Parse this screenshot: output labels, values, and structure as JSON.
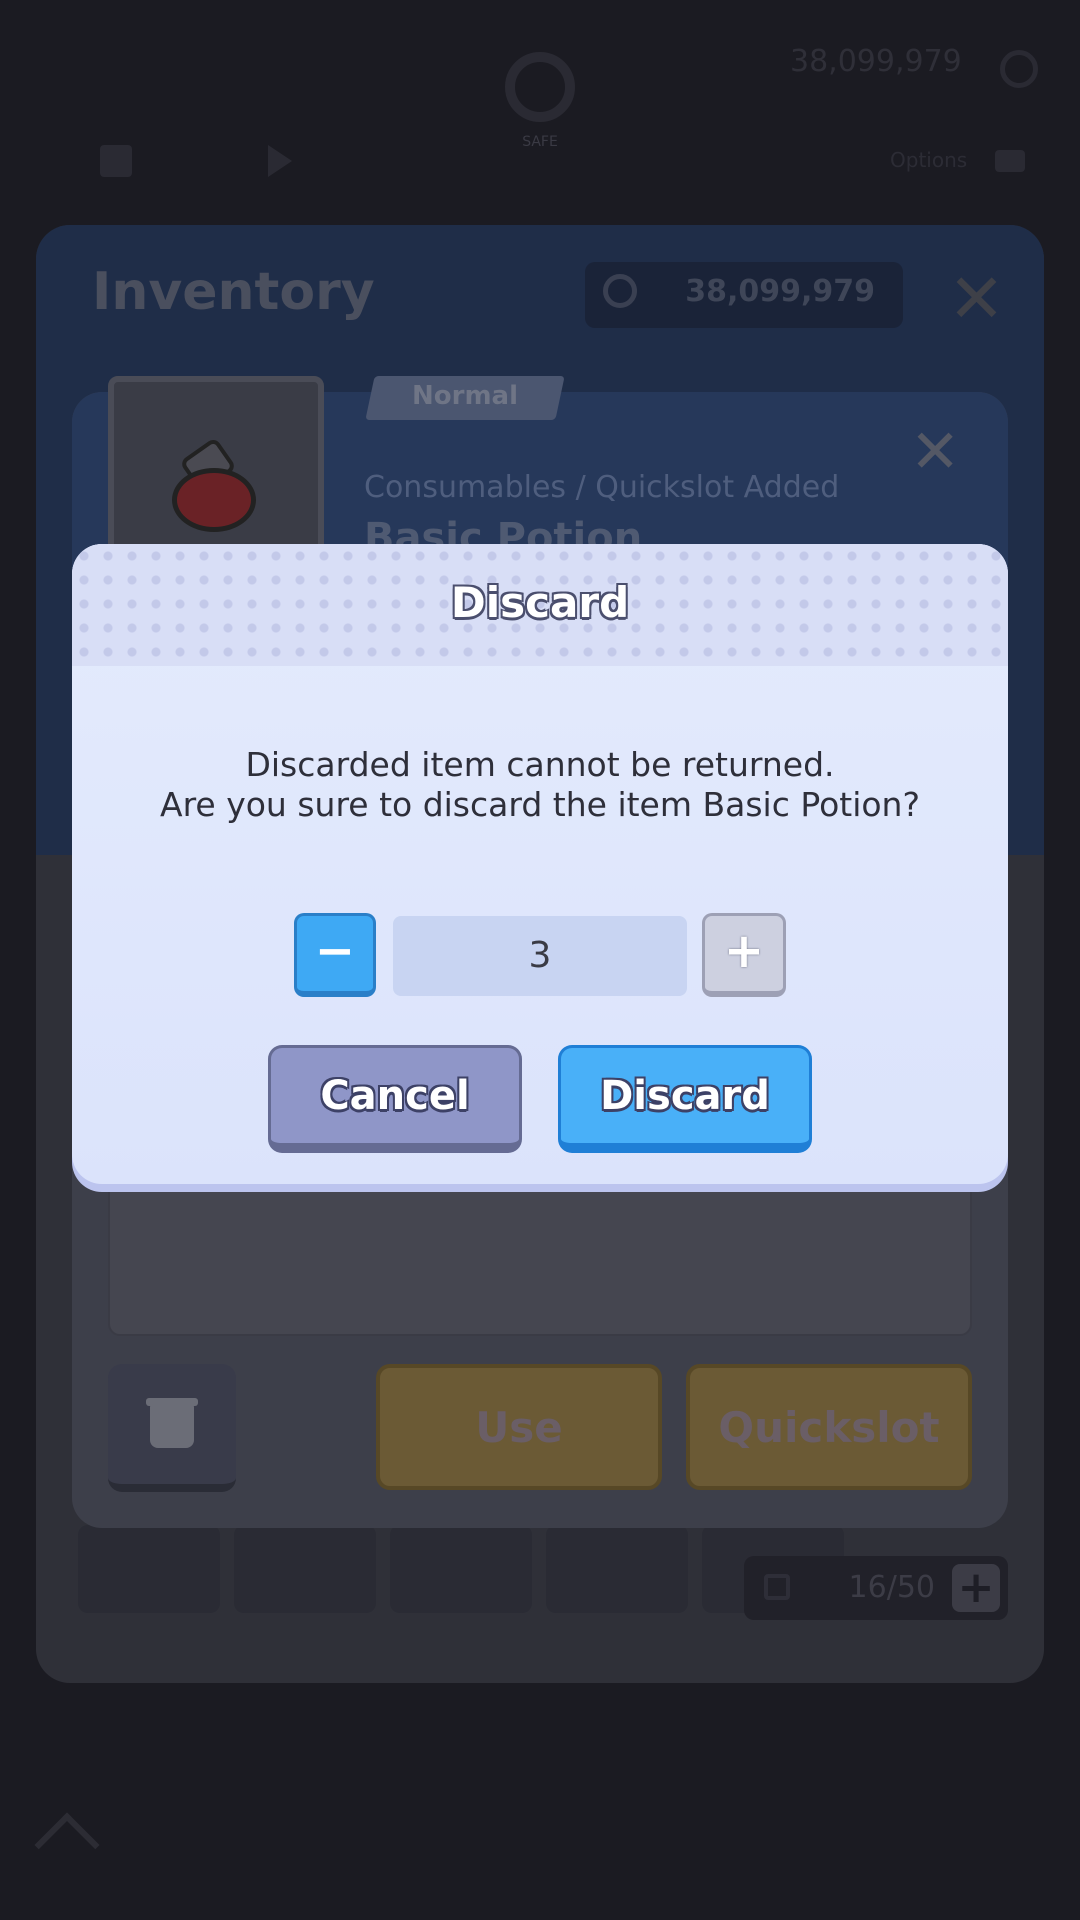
{
  "hud": {
    "safe_label": "SAFE",
    "gold": "38,099,979",
    "menu_label": "Options"
  },
  "inventory": {
    "title": "Inventory",
    "gold": "38,099,979",
    "slots_count": "16/50"
  },
  "item": {
    "grade": "Normal",
    "category": "Consumables / Quickslot Added",
    "name": "Basic Potion",
    "use_label": "Use",
    "quickslot_label": "Quickslot"
  },
  "dialog": {
    "title": "Discard",
    "message_line1": "Discarded item cannot be returned.",
    "message_line2": "Are you sure to discard the item Basic Potion?",
    "quantity": "3",
    "minus_label": "−",
    "plus_label": "+",
    "cancel_label": "Cancel",
    "discard_label": "Discard"
  },
  "colors": {
    "discard_button": "#49b0f8",
    "cancel_button": "#8f96c8",
    "dialog_bg": "#e4ebfd"
  }
}
